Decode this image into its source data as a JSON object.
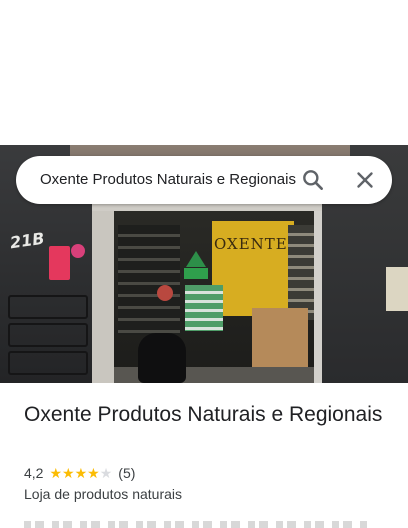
{
  "search": {
    "query": "Oxente Produtos Naturais e Regionais",
    "search_icon": "search-icon",
    "close_icon": "close-icon"
  },
  "photo": {
    "store_number": "21B",
    "store_sign": "OXENTE"
  },
  "place": {
    "name": "Oxente Produtos Naturais e Regionais",
    "rating": "4,2",
    "stars_filled": 4,
    "stars_total": 5,
    "reviews": "(5)",
    "category": "Loja de produtos naturais"
  },
  "colors": {
    "star_filled": "#fbbc04",
    "star_empty": "#dadce0",
    "text_primary": "#202124",
    "text_secondary": "#3c4043",
    "icon_gray": "#5f6368"
  }
}
